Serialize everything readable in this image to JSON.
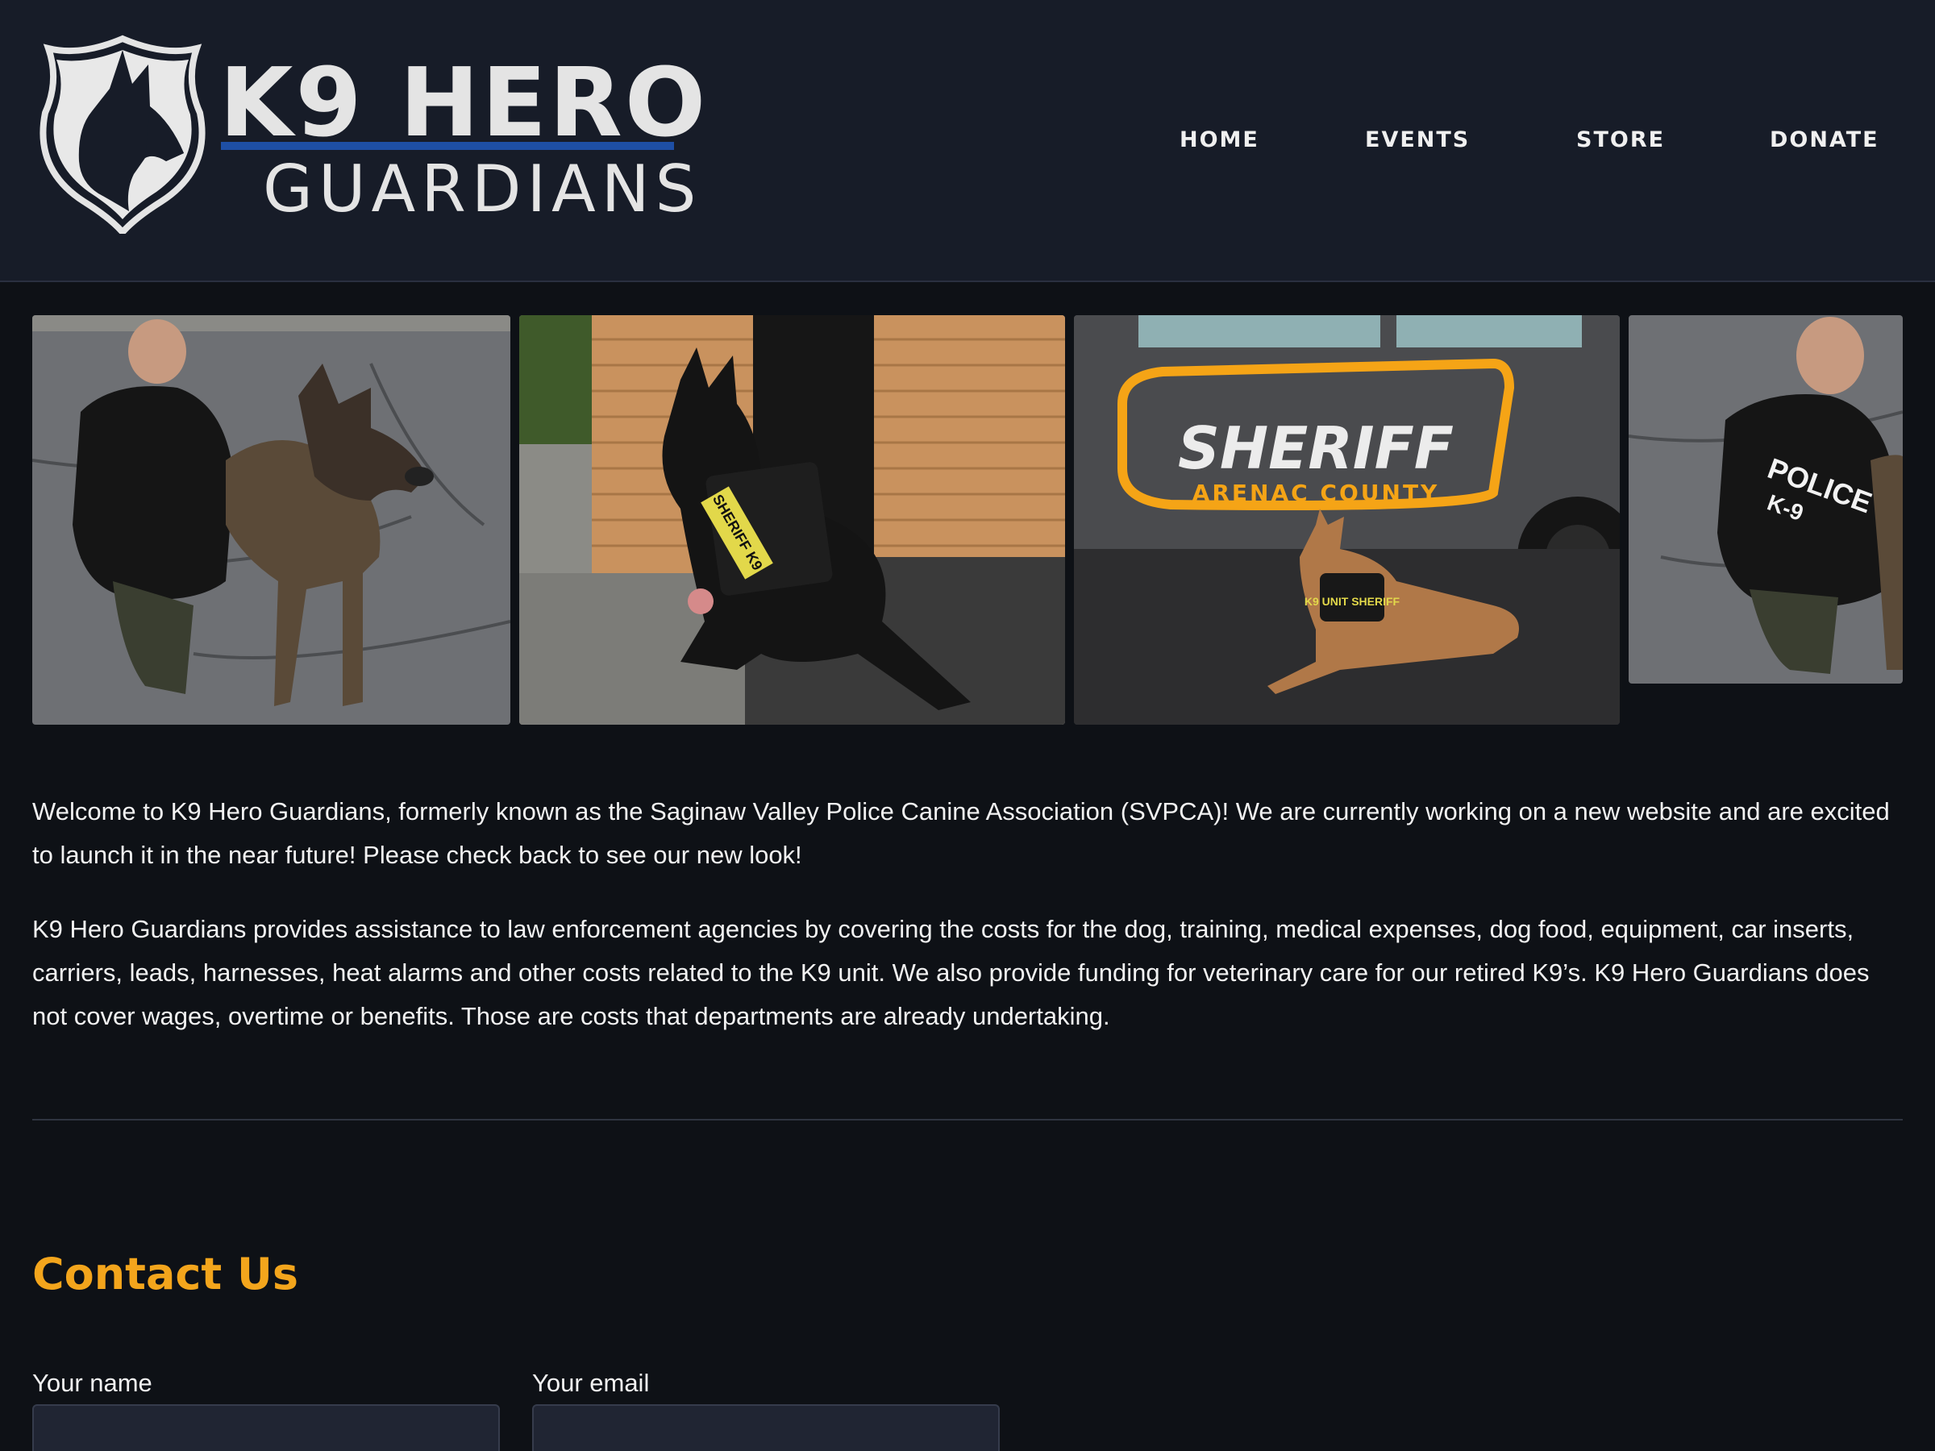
{
  "site": {
    "logo_title": "K9 HERO",
    "logo_subtitle": "GUARDIANS"
  },
  "nav": {
    "items": [
      {
        "label": "HOME"
      },
      {
        "label": "EVENTS"
      },
      {
        "label": "STORE"
      },
      {
        "label": "DONATE"
      }
    ]
  },
  "gallery": {
    "photos": [
      {
        "icon": "photo-officer-with-german-shepherd"
      },
      {
        "icon": "photo-black-dog-sheriff-k9-vest"
      },
      {
        "icon": "photo-malinois-by-sheriff-car",
        "car_text": "SHERIFF",
        "car_subtext": "ARENAC COUNTY",
        "vest_text": "K9 UNIT SHERIFF"
      },
      {
        "icon": "photo-officer-with-dog-partial"
      }
    ],
    "vest_label": "SHERIFF K9",
    "shirt_text": "POLICE",
    "shirt_sub": "K-9"
  },
  "main": {
    "intro": "Welcome to K9 Hero Guardians, formerly known as the Saginaw Valley Police Canine Association (SVPCA)! We are currently working on a new website and are excited to launch it in the near future! Please check back to see our new look!",
    "description": "K9 Hero Guardians provides assistance to law enforcement agencies by covering the costs for the dog, training, medical expenses, dog food, equipment, car inserts, carriers, leads, harnesses, heat alarms and other costs related to the K9 unit. We also provide funding for veterinary care for our retired K9’s. K9 Hero Guardians does not cover wages, overtime or benefits. Those are costs that departments are already undertaking."
  },
  "contact": {
    "title": "Contact Us",
    "name_label": "Your name",
    "email_label": "Your email",
    "name_value": "",
    "email_value": ""
  },
  "colors": {
    "header_bg": "#171c28",
    "page_bg": "#0e1116",
    "accent": "#f3a51c",
    "logo_bar": "#1e4fa5"
  }
}
